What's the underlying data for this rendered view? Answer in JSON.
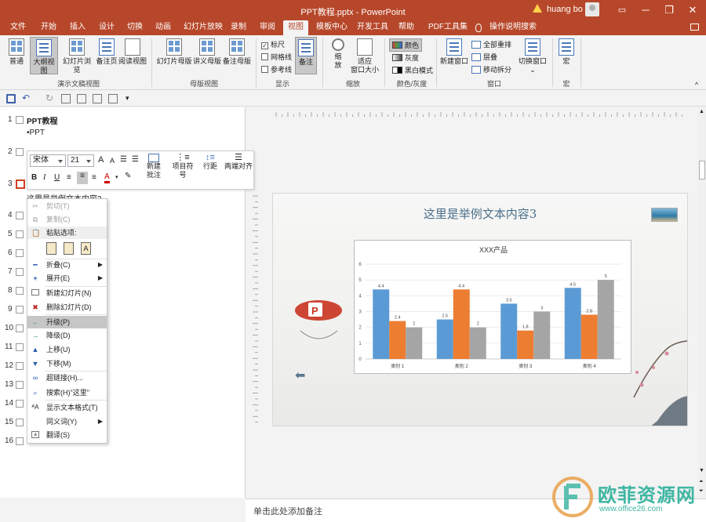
{
  "titlebar": {
    "title": "PPT教程.pptx - PowerPoint",
    "user": "huang bo",
    "minimize": "─",
    "restore": "❐",
    "close": "✕",
    "ribbon_display": "▭"
  },
  "tabs": [
    "文件",
    "开始",
    "插入",
    "设计",
    "切换",
    "动画",
    "幻灯片放映",
    "录制",
    "审阅",
    "视图",
    "模板中心",
    "开发工具",
    "帮助",
    "PDF工具集",
    "操作说明搜索"
  ],
  "ribbon": {
    "views": {
      "normal": "普通",
      "outline": "大纲视图",
      "sorter": "幻灯片浏览",
      "notes_page": "备注页",
      "reading": "阅读视图",
      "group": "演示文稿视图"
    },
    "master": {
      "slide_master": "幻灯片母版",
      "handout_master": "讲义母版",
      "notes_master": "备注母版",
      "group": "母版视图"
    },
    "show": {
      "ruler": "标尺",
      "gridlines": "网格线",
      "guides": "参考线",
      "notes": "备注",
      "group": "显示"
    },
    "zoom": {
      "zoom_l1": "缩",
      "zoom_l2": "放",
      "fit_l1": "适应",
      "fit_l2": "窗口大小",
      "group": "缩放"
    },
    "color": {
      "color": "颜色",
      "grayscale": "灰度",
      "bw": "黑白模式",
      "group": "颜色/灰度"
    },
    "window": {
      "new_window": "新建窗口",
      "arrange_all": "全部重排",
      "cascade": "层叠",
      "move_split": "移动拆分",
      "switch": "切换窗口",
      "group": "窗口"
    },
    "macros": {
      "macro": "宏",
      "group": "宏"
    }
  },
  "outline": {
    "slides": [
      {
        "num": "1",
        "title": "PPT教程",
        "bullet": "•PPT"
      },
      {
        "num": "2"
      },
      {
        "num": "3",
        "text": "这里是举例文本内容3"
      },
      {
        "num": "4"
      },
      {
        "num": "5"
      },
      {
        "num": "6"
      },
      {
        "num": "7"
      },
      {
        "num": "8"
      },
      {
        "num": "9"
      },
      {
        "num": "10"
      },
      {
        "num": "11"
      },
      {
        "num": "12"
      },
      {
        "num": "13"
      },
      {
        "num": "14"
      },
      {
        "num": "15"
      },
      {
        "num": "16"
      }
    ]
  },
  "mini_toolbar": {
    "font": "宋体",
    "size": "21",
    "new_comment_l1": "新建",
    "new_comment_l2": "批注",
    "bullets_l1": "项目符",
    "bullets_l2": "号",
    "line_spacing": "行距",
    "justify": "两端对齐",
    "bold": "B",
    "italic": "I",
    "grow": "A",
    "shrink": "A",
    "font_color": "A"
  },
  "context_menu": {
    "cut": "剪切(T)",
    "copy": "复制(C)",
    "paste_options": "粘贴选项:",
    "collapse": "折叠(C)",
    "expand": "展开(E)",
    "new_slide": "新建幻灯片(N)",
    "delete_slide": "删除幻灯片(D)",
    "promote": "升级(P)",
    "demote": "降级(D)",
    "move_up": "上移(U)",
    "move_down": "下移(M)",
    "hyperlink": "超链接(H)...",
    "search": "搜索(H)\"这里\"",
    "show_format": "显示文本格式(T)",
    "synonyms": "同义词(Y)",
    "translate": "翻译(S)"
  },
  "slide": {
    "title": "这里是举例文本内容3",
    "colors": {
      "blue": "#5b9bd5",
      "orange": "#ed7d31",
      "gray": "#a5a5a5"
    }
  },
  "chart_data": {
    "type": "bar",
    "title": "XXX产品",
    "categories": [
      "类别 1",
      "类别 2",
      "类别 3",
      "类别 4"
    ],
    "series": [
      {
        "values": [
          4.4,
          2.5,
          3.5,
          4.5
        ]
      },
      {
        "values": [
          2.4,
          4.4,
          1.8,
          2.8
        ]
      },
      {
        "values": [
          2,
          2,
          3,
          5
        ]
      }
    ],
    "data_labels": [
      [
        "4.4",
        "2.5",
        "3.5",
        "4.5"
      ],
      [
        "2.4",
        "4.4",
        "1.8",
        "2.8"
      ],
      [
        "2",
        "2",
        "3",
        "5"
      ]
    ],
    "ylim": [
      0,
      6
    ],
    "yticks": [
      "0",
      "1",
      "2",
      "3",
      "4",
      "5",
      "6"
    ],
    "grid": true
  },
  "notes": {
    "placeholder": "单击此处添加备注"
  },
  "watermark": {
    "name": "欧菲资源网",
    "url": "www.office26.com"
  }
}
